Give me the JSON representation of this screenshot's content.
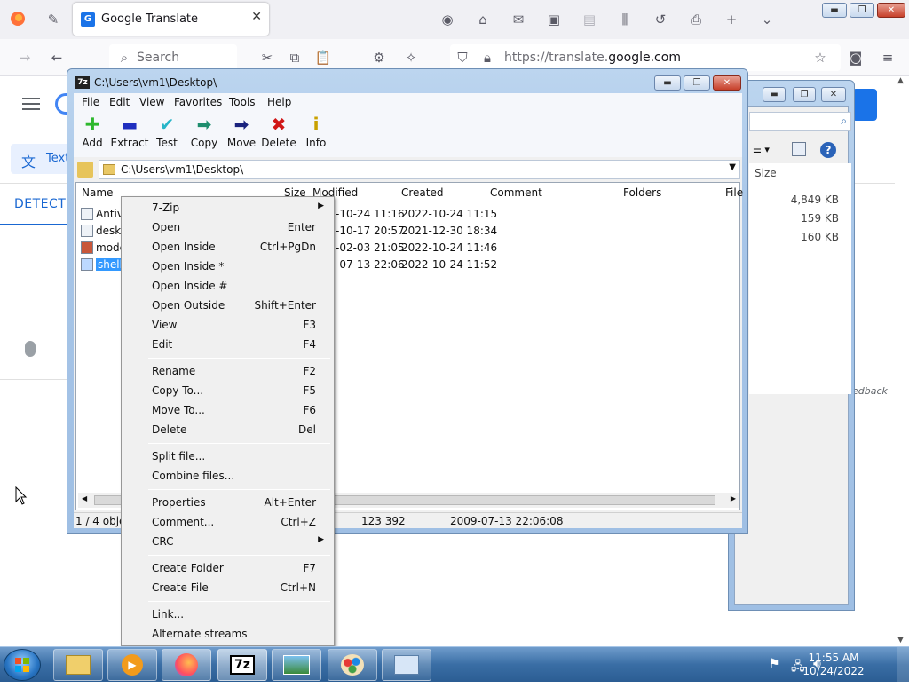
{
  "firefox": {
    "tab_title": "Google Translate",
    "tab_favicon": "G",
    "search_label": "Search",
    "url_prefix": "https://translate.",
    "url_host": "google.com"
  },
  "translate_page": {
    "text_tab": "Text",
    "detect_label": "DETECT L",
    "feedback_label": "edback"
  },
  "win2": {
    "col_size": "Size",
    "sizes": [
      "4,849 KB",
      "159 KB",
      "160 KB"
    ]
  },
  "win1": {
    "caption": "C:\\Users\\vm1\\Desktop\\",
    "caption_icon": "7z",
    "menu": [
      "File",
      "Edit",
      "View",
      "Favorites",
      "Tools",
      "Help"
    ],
    "toolbar": [
      {
        "label": "Add",
        "icon": "✚",
        "color": "#2db82d"
      },
      {
        "label": "Extract",
        "icon": "▬",
        "color": "#1f2fbf"
      },
      {
        "label": "Test",
        "icon": "✔",
        "color": "#27b5c8"
      },
      {
        "label": "Copy",
        "icon": "➡",
        "color": "#1e8e6e"
      },
      {
        "label": "Move",
        "icon": "➡",
        "color": "#1a237e"
      },
      {
        "label": "Delete",
        "icon": "✖",
        "color": "#d01717"
      },
      {
        "label": "Info",
        "icon": "i",
        "color": "#c9a100"
      }
    ],
    "address": "C:\\Users\\vm1\\Desktop\\",
    "columns": [
      "Name",
      "Size",
      "Modified",
      "Created",
      "Comment",
      "Folders",
      "File"
    ],
    "rows": [
      {
        "name": "Antiv",
        "modified": "-10-24 11:16",
        "created": "2022-10-24 11:15",
        "selected": false
      },
      {
        "name": "deskt",
        "modified": "-10-17 20:57",
        "created": "2021-12-30 18:34",
        "selected": false
      },
      {
        "name": "mode",
        "modified": "-02-03 21:05",
        "created": "2022-10-24 11:46",
        "selected": false
      },
      {
        "name": "shells",
        "modified": "-07-13 22:06",
        "created": "2022-10-24 11:52",
        "selected": true
      }
    ],
    "status": {
      "count": "1 / 4 objec",
      "size": "123 392",
      "date": "2009-07-13 22:06:08"
    }
  },
  "context_menu": {
    "items": [
      {
        "label": "7-Zip",
        "shortcut": "",
        "submenu": true
      },
      {
        "label": "Open",
        "shortcut": "Enter"
      },
      {
        "label": "Open Inside",
        "shortcut": "Ctrl+PgDn"
      },
      {
        "label": "Open Inside *",
        "shortcut": ""
      },
      {
        "label": "Open Inside #",
        "shortcut": ""
      },
      {
        "label": "Open Outside",
        "shortcut": "Shift+Enter"
      },
      {
        "label": "View",
        "shortcut": "F3"
      },
      {
        "label": "Edit",
        "shortcut": "F4"
      },
      {
        "label": "Rename",
        "shortcut": "F2"
      },
      {
        "label": "Copy To...",
        "shortcut": "F5"
      },
      {
        "label": "Move To...",
        "shortcut": "F6"
      },
      {
        "label": "Delete",
        "shortcut": "Del"
      },
      {
        "label": "Split file...",
        "shortcut": ""
      },
      {
        "label": "Combine files...",
        "shortcut": ""
      },
      {
        "label": "Properties",
        "shortcut": "Alt+Enter"
      },
      {
        "label": "Comment...",
        "shortcut": "Ctrl+Z"
      },
      {
        "label": "CRC",
        "shortcut": "",
        "submenu": true
      },
      {
        "label": "Create Folder",
        "shortcut": "F7"
      },
      {
        "label": "Create File",
        "shortcut": "Ctrl+N"
      },
      {
        "label": "Link...",
        "shortcut": ""
      },
      {
        "label": "Alternate streams",
        "shortcut": ""
      }
    ]
  },
  "taskbar": {
    "apps": [
      "explorer",
      "media-player",
      "firefox",
      "7z",
      "photo-viewer",
      "paint",
      "control-panel"
    ],
    "app_7z_label": "7z",
    "time": "11:55 AM",
    "date": "10/24/2022"
  }
}
